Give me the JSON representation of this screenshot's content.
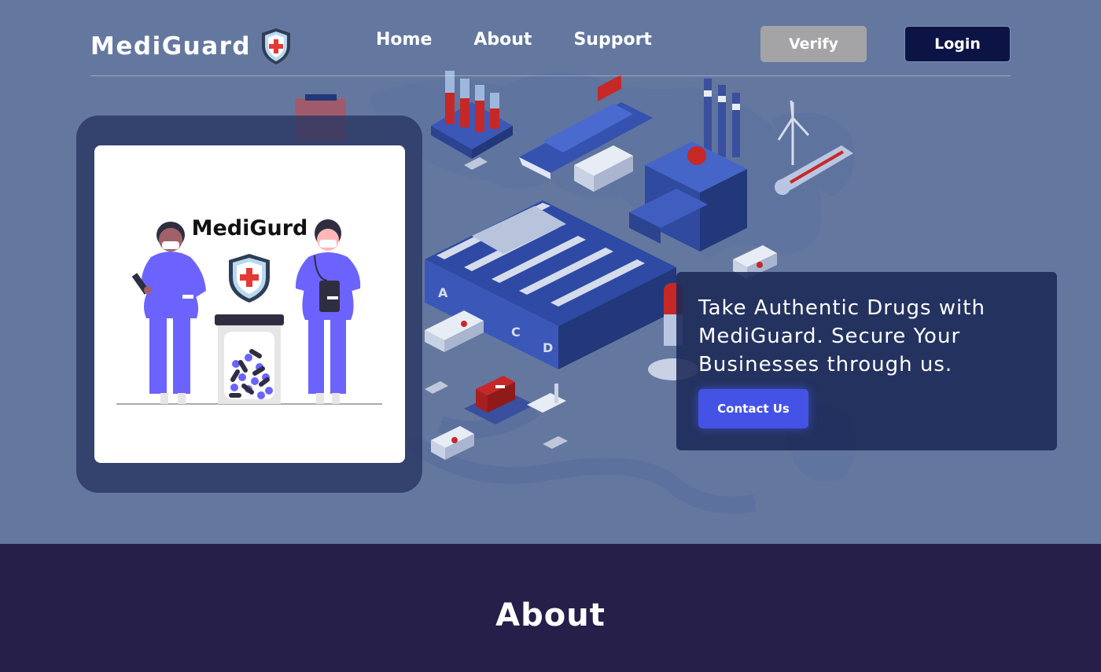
{
  "brand": {
    "name": "MediGuard",
    "logo_icon": "shield-cross-icon"
  },
  "nav": {
    "links": [
      {
        "label": "Home"
      },
      {
        "label": "About"
      },
      {
        "label": "Support"
      }
    ],
    "verify_label": "Verify",
    "login_label": "Login"
  },
  "hero": {
    "card_title": "MediGurd",
    "tagline": "Take Authentic Drugs with MediGuard. Secure Your Businesses through us.",
    "contact_label": "Contact Us",
    "warehouse_labels": [
      "A",
      "C",
      "D"
    ]
  },
  "about": {
    "title": "About"
  },
  "colors": {
    "hero_bg": "#64789f",
    "login_bg": "#0c1446",
    "verify_bg": "#a4a4a6",
    "contact_bg": "#4453e6",
    "about_bg": "#251f4a",
    "figure_purple": "#6c63ff",
    "cross_red": "#e53935"
  }
}
